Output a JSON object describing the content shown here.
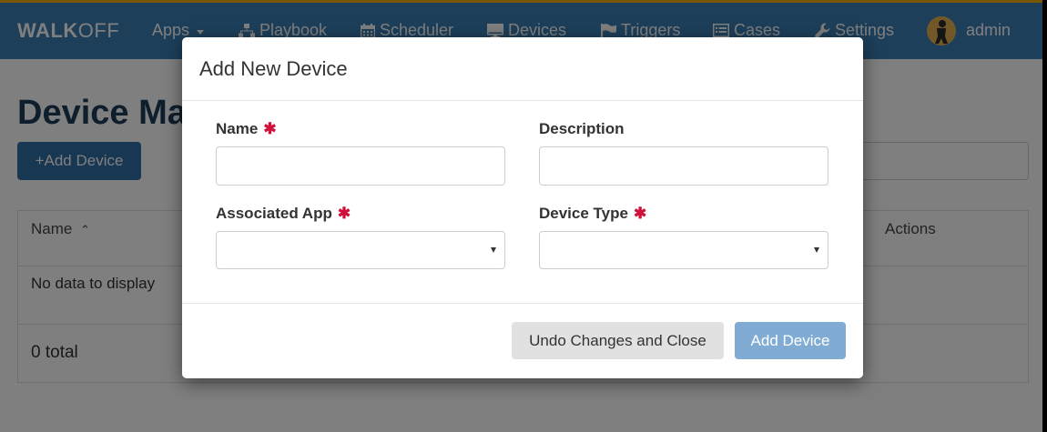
{
  "navbar": {
    "brand_bold": "WALK",
    "brand_light": "OFF",
    "items": [
      {
        "label": "Apps",
        "icon": "caret-down-icon"
      },
      {
        "label": "Playbook",
        "icon": "sitemap-icon"
      },
      {
        "label": "Scheduler",
        "icon": "calendar-icon"
      },
      {
        "label": "Devices",
        "icon": "monitor-icon"
      },
      {
        "label": "Triggers",
        "icon": "flag-icon"
      },
      {
        "label": "Cases",
        "icon": "list-icon"
      },
      {
        "label": "Settings",
        "icon": "wrench-icon"
      }
    ],
    "user": "admin"
  },
  "page": {
    "title": "Device Ma",
    "add_button": "+Add Device",
    "table": {
      "columns": [
        "Name",
        "Actions"
      ],
      "empty_message": "No data to display",
      "total": "0 total"
    }
  },
  "modal": {
    "title": "Add New Device",
    "fields": {
      "name": {
        "label": "Name",
        "required": "✱",
        "value": ""
      },
      "description": {
        "label": "Description",
        "value": ""
      },
      "associated_app": {
        "label": "Associated App",
        "required": "✱",
        "selected": ""
      },
      "device_type": {
        "label": "Device Type",
        "required": "✱",
        "selected": ""
      }
    },
    "buttons": {
      "undo": "Undo Changes and Close",
      "add": "Add Device"
    }
  },
  "colors": {
    "navbar": "#3a7fb5",
    "accent_line": "#f0ad00",
    "required": "#d0103a",
    "primary_button": "#80acd3"
  }
}
